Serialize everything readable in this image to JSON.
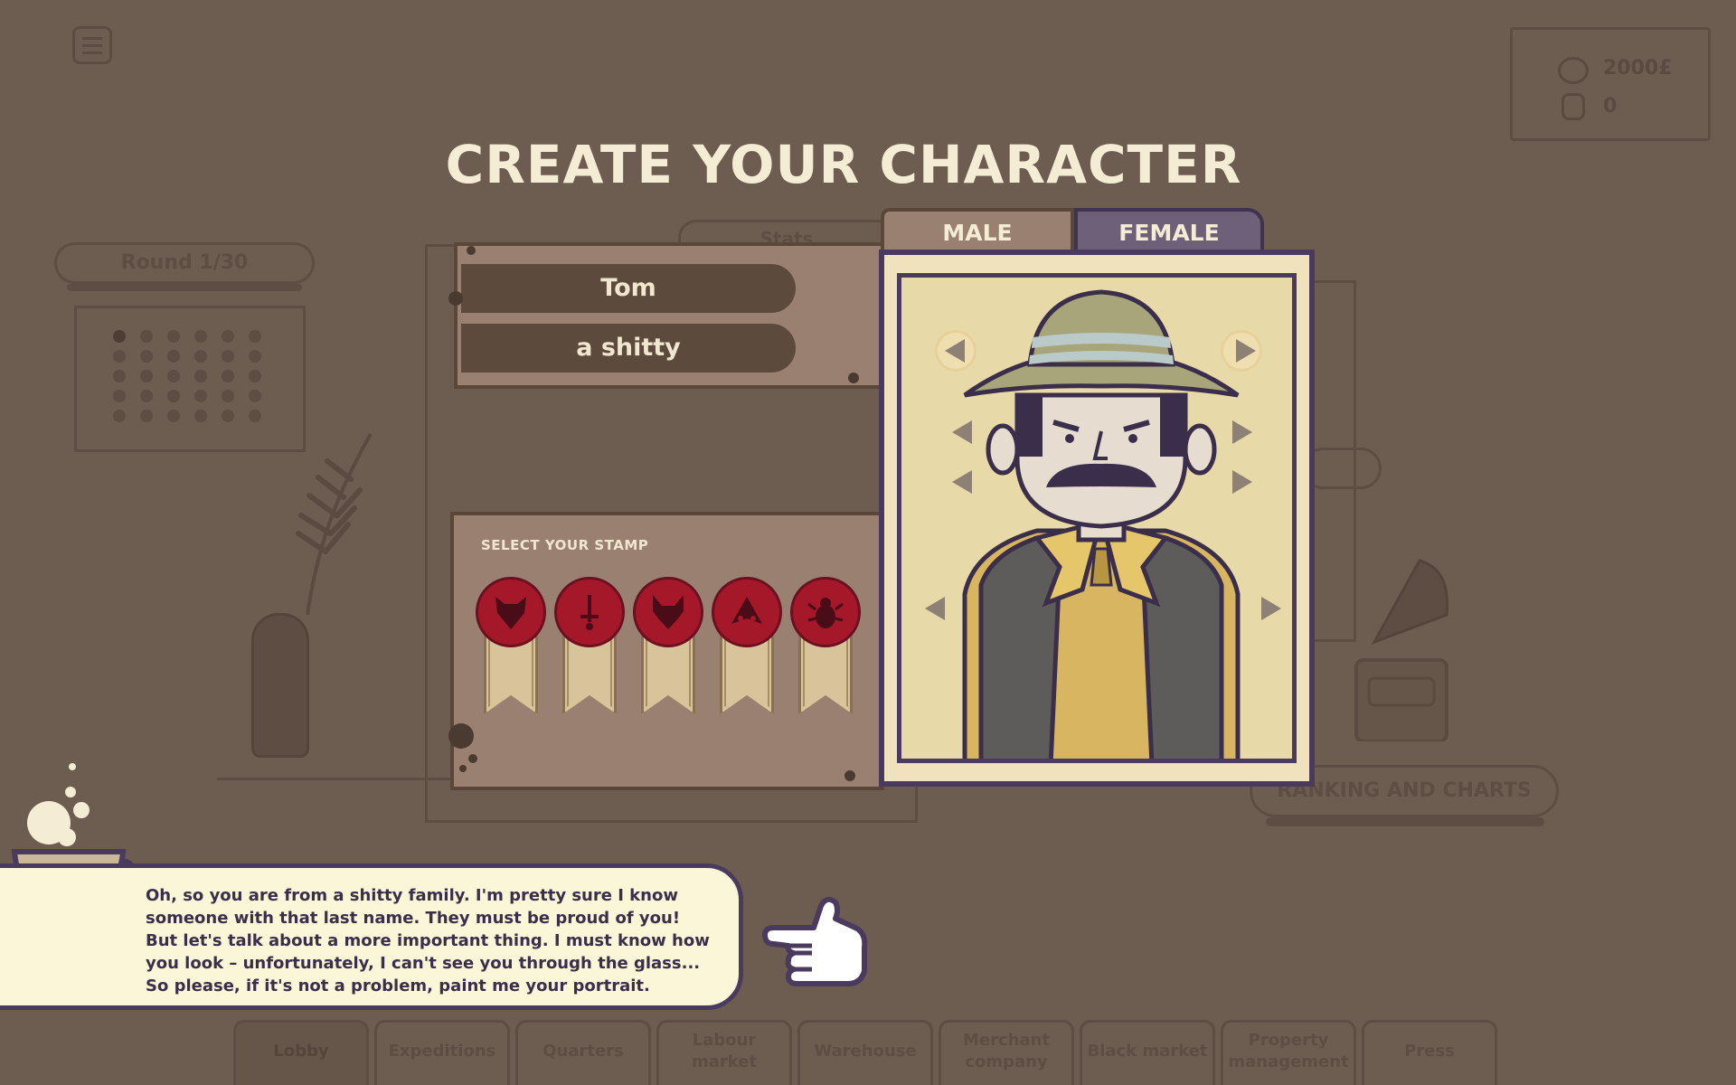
{
  "title": "CREATE YOUR CHARACTER",
  "hud": {
    "money": "2000£",
    "items": "0",
    "round": "Round 1/30",
    "stats_tab": "Stats"
  },
  "character": {
    "first_name": "Tom",
    "family": "a shitty"
  },
  "stamps": {
    "label": "SELECT YOUR STAMP",
    "items": [
      {
        "name": "fox-stamp"
      },
      {
        "name": "sword-stamp"
      },
      {
        "name": "wolf-stamp"
      },
      {
        "name": "moth-stamp"
      },
      {
        "name": "beetle-stamp"
      }
    ]
  },
  "gender": {
    "male": "MALE",
    "female": "FEMALE",
    "selected": "male"
  },
  "dialogue": {
    "text": "Oh, so you are from a shitty family. I'm pretty sure I know someone with that last name. They must be proud of you! But let's talk about a more important thing. I must know how you look – unfortunately, I can't see you through the glass... So please, if it's not a problem, paint me your portrait."
  },
  "ranking_button": "RANKING AND CHARTS",
  "nav": {
    "tabs": [
      {
        "label": "Lobby"
      },
      {
        "label": "Expeditions"
      },
      {
        "label": "Quarters"
      },
      {
        "label": "Labour market"
      },
      {
        "label": "Warehouse"
      },
      {
        "label": "Merchant company"
      },
      {
        "label": "Black market"
      },
      {
        "label": "Property management"
      },
      {
        "label": "Press"
      }
    ]
  },
  "colors": {
    "background": "#6d5c50",
    "title": "#f4ecd4",
    "card": "#9a8070",
    "stamp_red": "#a4182a",
    "frame": "#4a3a5e",
    "speech_bg": "#fcf6d8"
  }
}
